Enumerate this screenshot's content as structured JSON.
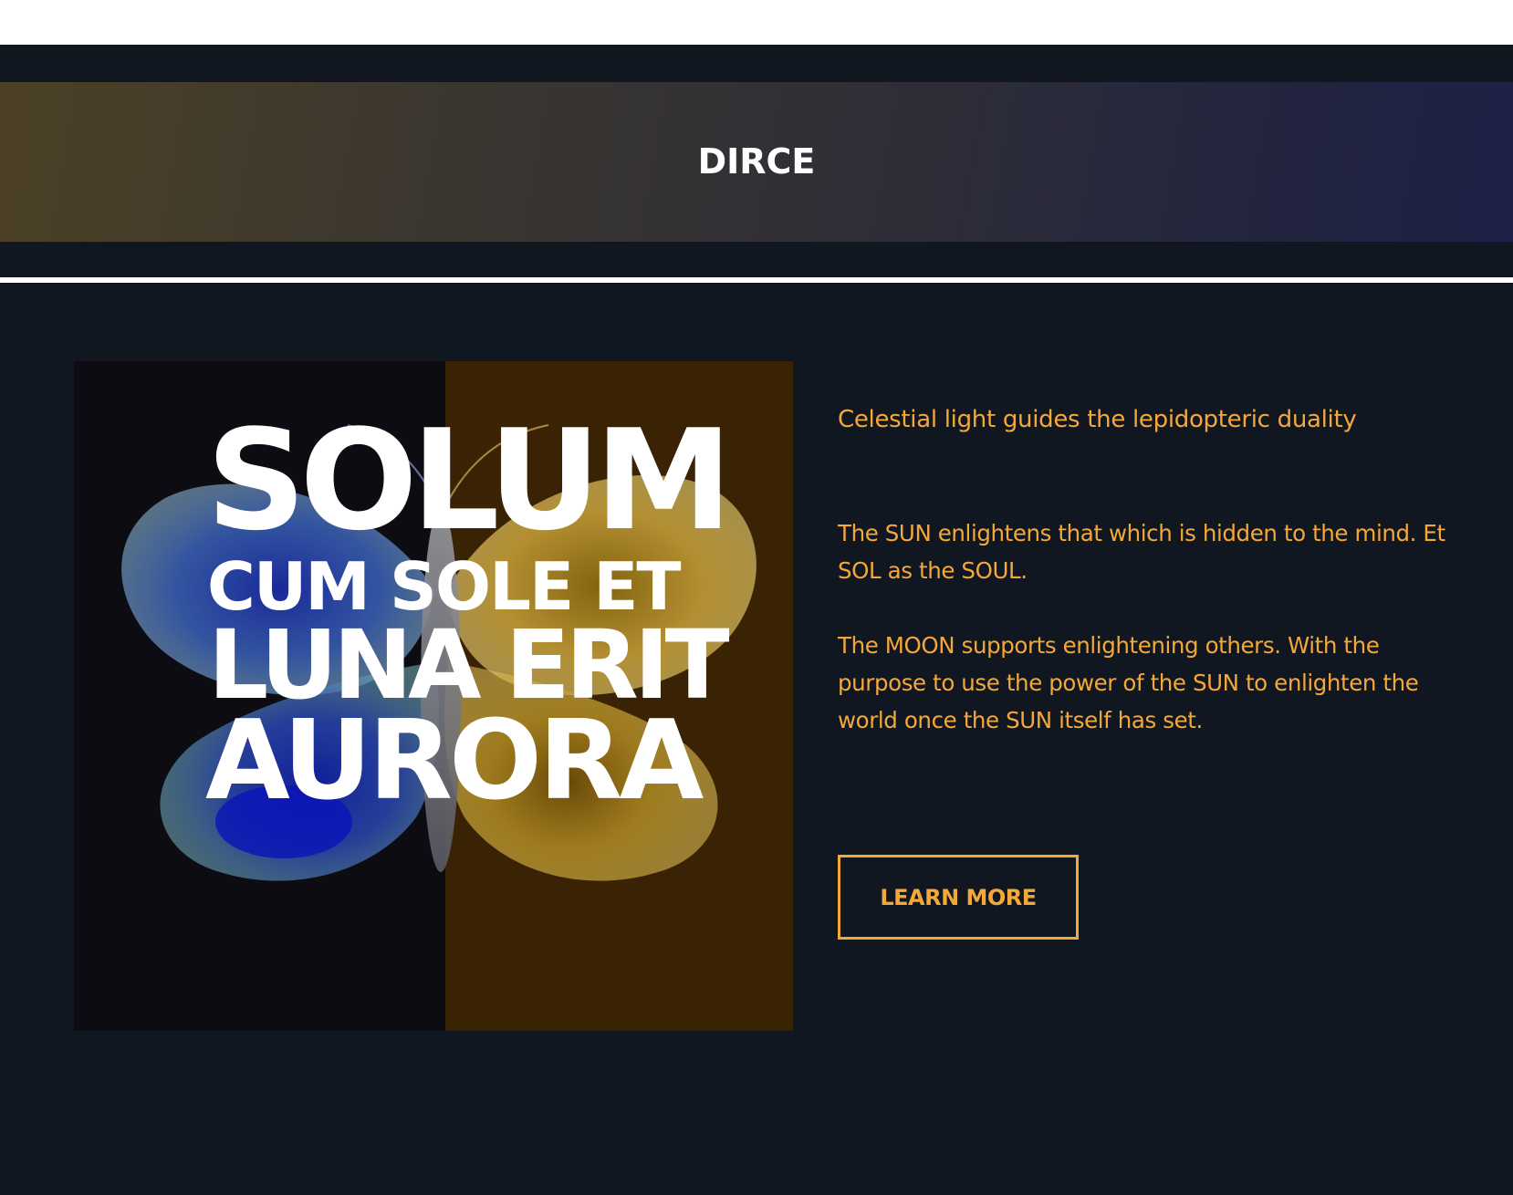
{
  "header": {
    "title": "DIRCE"
  },
  "hero": {
    "line1": "SOLUM",
    "line2": "CUM SOLE ET",
    "line3": "LUNA ERIT",
    "line4": "AURORA"
  },
  "content": {
    "tagline": "Celestial light guides the lepidopteric duality",
    "paragraph_sun": "The SUN enlightens that which is hidden to the mind. Et SOL as the SOUL.",
    "paragraph_moon": "The MOON supports enlightening others. With the purpose to use the power of the SUN to enlighten the world once the SUN itself has set.",
    "button_label": "LEARN MORE"
  },
  "colors": {
    "background": "#111720",
    "accent": "#f4a83a",
    "banner_start": "#4c4126",
    "banner_end": "#1d2147",
    "image_left": "#0d0c13",
    "image_right": "#3a2204"
  }
}
